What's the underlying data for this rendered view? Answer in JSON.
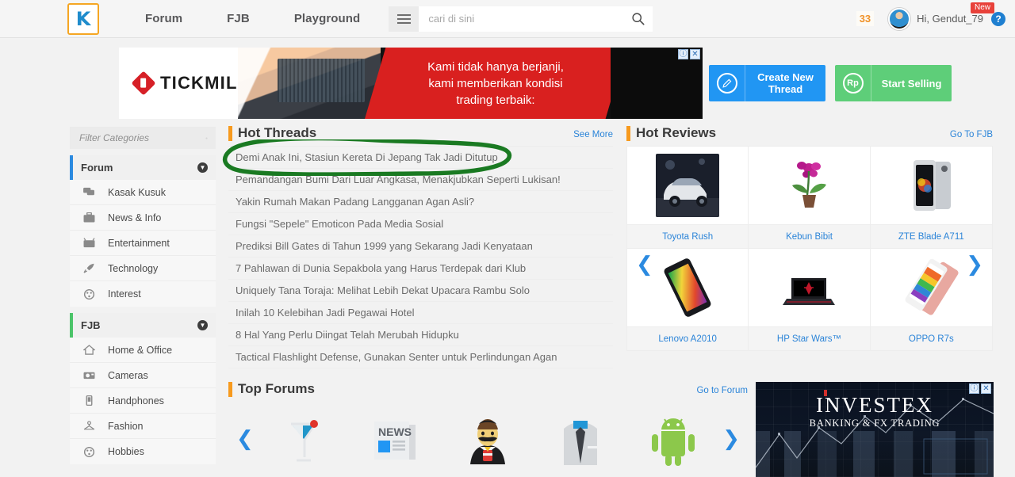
{
  "header": {
    "logo_text": "K",
    "nav": [
      {
        "label": "Forum"
      },
      {
        "label": "FJB"
      },
      {
        "label": "Playground"
      }
    ],
    "menu_icon": "hamburger-icon",
    "search": {
      "placeholder": "cari di sini",
      "value": "",
      "icon": "search-icon"
    },
    "notification_count": "33",
    "greeting": "Hi, Gendut_79",
    "new_badge": "New",
    "help_icon_label": "?"
  },
  "ad_top": {
    "brand": "TICKMILL",
    "headline_line1": "Kami tidak hanya berjanji,",
    "headline_line2": "kami memberikan kondisi",
    "headline_line3": "trading terbaik:",
    "info_icon": "ⓘ",
    "close_icon": "✕"
  },
  "actions": [
    {
      "label_line1": "Create New",
      "label_line2": "Thread",
      "icon": "pencil-icon",
      "color": "#2196f3"
    },
    {
      "label_line1": "Start Selling",
      "label_line2": "",
      "icon": "rupiah-icon",
      "color": "#5ece79"
    }
  ],
  "sidebar": {
    "filter_placeholder": "Filter Categories",
    "filter_value": "",
    "groups": [
      {
        "title": "Forum",
        "accent": "#2b8ae0",
        "items": [
          {
            "label": "Kasak Kusuk",
            "icon": "chat-bubbles-icon"
          },
          {
            "label": "News & Info",
            "icon": "briefcase-icon"
          },
          {
            "label": "Entertainment",
            "icon": "tv-icon"
          },
          {
            "label": "Technology",
            "icon": "rocket-icon"
          },
          {
            "label": "Interest",
            "icon": "palette-icon"
          }
        ]
      },
      {
        "title": "FJB",
        "accent": "#4cc46a",
        "items": [
          {
            "label": "Home & Office",
            "icon": "home-icon"
          },
          {
            "label": "Cameras",
            "icon": "camera-icon"
          },
          {
            "label": "Handphones",
            "icon": "phone-icon"
          },
          {
            "label": "Fashion",
            "icon": "hanger-icon"
          },
          {
            "label": "Hobbies",
            "icon": "palette-icon"
          }
        ]
      }
    ]
  },
  "hot_threads": {
    "title": "Hot Threads",
    "link": "See More",
    "items": [
      {
        "title": "Demi Anak Ini, Stasiun Kereta Di Jepang Tak Jadi Ditutup",
        "highlighted": true
      },
      {
        "title": "Pemandangan Bumi Dari Luar Angkasa, Menakjubkan Seperti Lukisan!",
        "highlighted": false
      },
      {
        "title": "Yakin Rumah Makan Padang Langganan Agan Asli?",
        "highlighted": false
      },
      {
        "title": "Fungsi \"Sepele\" Emoticon Pada Media Sosial",
        "highlighted": false
      },
      {
        "title": "Prediksi Bill Gates di Tahun 1999 yang Sekarang Jadi Kenyataan",
        "highlighted": false
      },
      {
        "title": "7 Pahlawan di Dunia Sepakbola yang Harus Terdepak dari Klub",
        "highlighted": false
      },
      {
        "title": "Uniquely Tana Toraja: Melihat Lebih Dekat Upacara Rambu Solo",
        "highlighted": false
      },
      {
        "title": "Inilah 10 Kelebihan Jadi Pegawai Hotel",
        "highlighted": false
      },
      {
        "title": "8 Hal Yang Perlu Diingat Telah Merubah Hidupku",
        "highlighted": false
      },
      {
        "title": "Tactical Flashlight Defense, Gunakan Senter untuk Perlindungan Agan",
        "highlighted": false
      }
    ]
  },
  "hot_reviews": {
    "title": "Hot Reviews",
    "link": "Go To FJB",
    "prev_icon": "chevron-left-icon",
    "next_icon": "chevron-right-icon",
    "items": [
      {
        "name": "Toyota Rush",
        "thumb": "car-photo"
      },
      {
        "name": "Kebun Bibit",
        "thumb": "orchid-plant-photo"
      },
      {
        "name": "ZTE Blade A711",
        "thumb": "silver-smartphone-photo"
      },
      {
        "name": "Lenovo A2010",
        "thumb": "black-smartphone-photo"
      },
      {
        "name": "HP Star Wars™",
        "thumb": "gaming-laptop-photo"
      },
      {
        "name": "OPPO R7s",
        "thumb": "colorful-smartphone-photo"
      }
    ]
  },
  "top_forums": {
    "title": "Top Forums",
    "link": "Go to Forum",
    "prev_icon": "chevron-left-icon",
    "next_icon": "chevron-right-icon",
    "items": [
      {
        "icon": "cocktail-glass-icon"
      },
      {
        "icon": "newspaper-icon",
        "text": "NEWS"
      },
      {
        "icon": "mustache-man-icon"
      },
      {
        "icon": "shirt-tie-icon"
      },
      {
        "icon": "android-robot-icon"
      }
    ]
  },
  "ad_bottom": {
    "brand": "INVESTEX",
    "tagline": "BANKING & FX TRADING",
    "info_icon": "ⓘ",
    "close_icon": "✕"
  },
  "annotation": {
    "type": "hand-drawn-circle",
    "color": "#1a7a22",
    "target": "Demi Anak Ini, Stasiun Kereta Di Jepang Tak Jadi Ditutup"
  },
  "colors": {
    "accent_orange": "#f79a1e",
    "link_blue": "#2b84d8",
    "forum_accent": "#2b8ae0",
    "fjb_accent": "#4cc46a",
    "page_bg": "#f2f2f2",
    "annotation_green": "#1a7a22"
  }
}
